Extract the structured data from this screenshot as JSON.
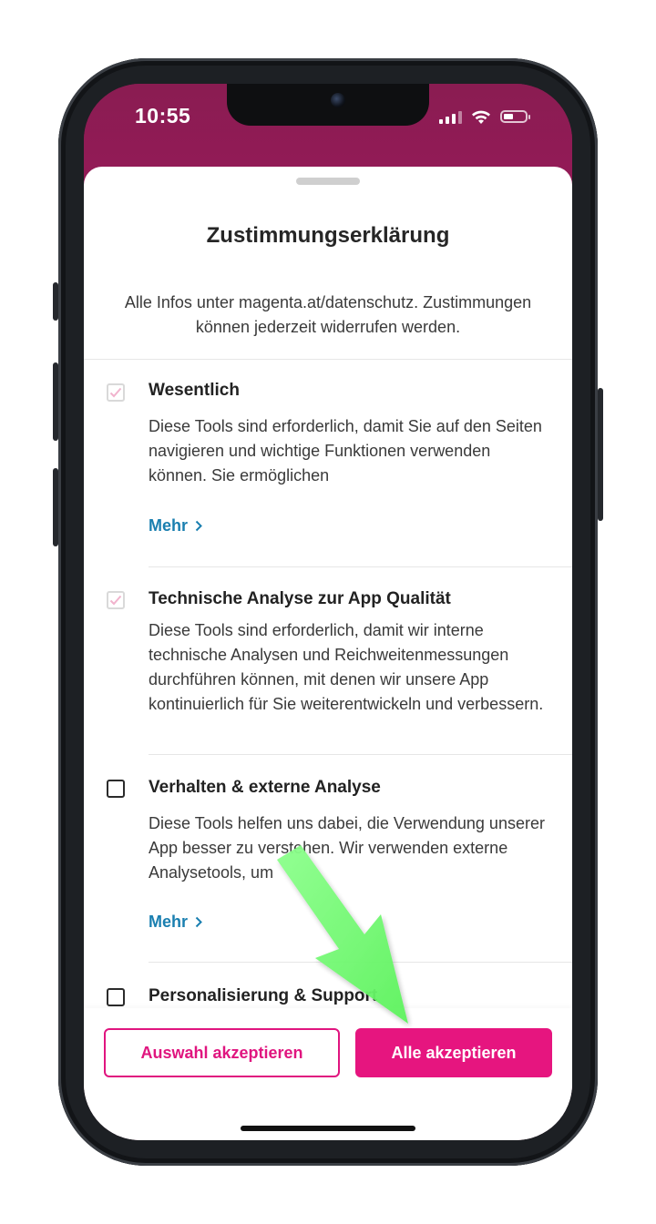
{
  "status_bar": {
    "time": "10:55"
  },
  "sheet": {
    "title": "Zustimmungserklärung",
    "intro": "Alle Infos unter magenta.at/datenschutz. Zustimmungen können jederzeit widerrufen werden."
  },
  "sections": [
    {
      "title": "Wesentlich",
      "text": "Diese Tools sind erforderlich, damit Sie auf den Seiten navigieren und wichtige Funktionen verwenden können. Sie ermöglichen",
      "more_label": "Mehr",
      "checked": true,
      "disabled": true
    },
    {
      "title": "Technische Analyse zur App Qualität",
      "text": "Diese Tools sind erforderlich, damit wir interne technische Analysen und Reichweitenmessungen durchführen können, mit denen wir unsere App kontinuierlich für Sie weiterentwickeln und verbessern.",
      "checked": true,
      "disabled": true
    },
    {
      "title": "Verhalten & externe Analyse",
      "text": "Diese Tools helfen uns dabei, die Verwendung unserer App besser zu verstehen. Wir verwenden externe Analysetools, um",
      "more_label": "Mehr",
      "checked": false,
      "disabled": false
    },
    {
      "title": "Personalisierung & Support",
      "checked": false,
      "disabled": false
    }
  ],
  "footer": {
    "accept_selection_label": "Auswahl akzeptieren",
    "accept_all_label": "Alle akzeptieren"
  },
  "colors": {
    "brand_magenta": "#e6157f",
    "header_purple": "#8a1c52",
    "link_blue": "#1a7fb0",
    "annotation_arrow": "#7dff7d"
  }
}
